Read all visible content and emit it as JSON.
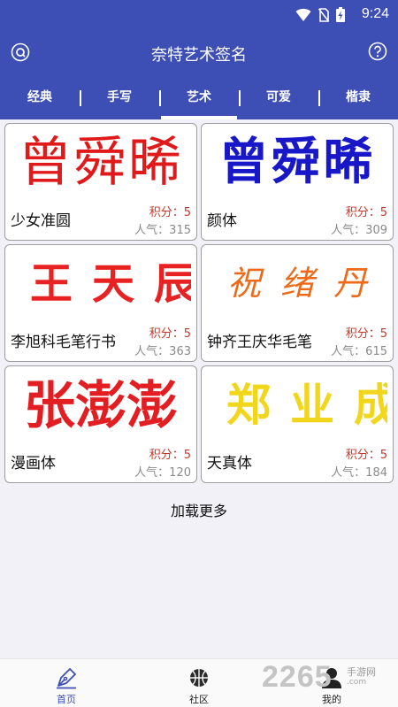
{
  "status": {
    "time": "9:24"
  },
  "app_title": "奈特艺术签名",
  "tabs": [
    {
      "label": "经典",
      "active": false
    },
    {
      "label": "手写",
      "active": false
    },
    {
      "label": "艺术",
      "active": true
    },
    {
      "label": "可爱",
      "active": false
    },
    {
      "label": "楷隶",
      "active": false
    }
  ],
  "cards": [
    {
      "preview": "曾舜晞",
      "name": "少女准圆",
      "score": "积分：5",
      "popularity": "人气：315",
      "color": "#e01a1a"
    },
    {
      "preview": "曾舜晞",
      "name": "颜体",
      "score": "积分：5",
      "popularity": "人气：309",
      "color": "#1818c8"
    },
    {
      "preview": "王天辰",
      "name": "李旭科毛笔行书",
      "score": "积分：5",
      "popularity": "人气：363",
      "color": "#e82222"
    },
    {
      "preview": "祝绪丹",
      "name": "钟齐王庆华毛笔",
      "score": "积分：5",
      "popularity": "人气：615",
      "color": "#ee6a18"
    },
    {
      "preview": "张澎澎",
      "name": "漫画体",
      "score": "积分：5",
      "popularity": "人气：120",
      "color": "#e21e22"
    },
    {
      "preview": "郑业成",
      "name": "天真体",
      "score": "积分：5",
      "popularity": "人气：184",
      "color": "#f2d61c"
    }
  ],
  "load_more": "加载更多",
  "bottom_nav": [
    {
      "label": "首页",
      "icon": "pen-icon",
      "active": true
    },
    {
      "label": "社区",
      "icon": "basketball-icon",
      "active": false
    },
    {
      "label": "我的",
      "icon": "user-icon",
      "active": false
    }
  ],
  "watermark": {
    "number": "2265",
    "text": "手游网",
    "url": ".com"
  },
  "colors": {
    "primary": "#3d4fb5",
    "score": "#c0392b",
    "popularity": "#8a8a8a",
    "background": "#f1f1f7"
  }
}
